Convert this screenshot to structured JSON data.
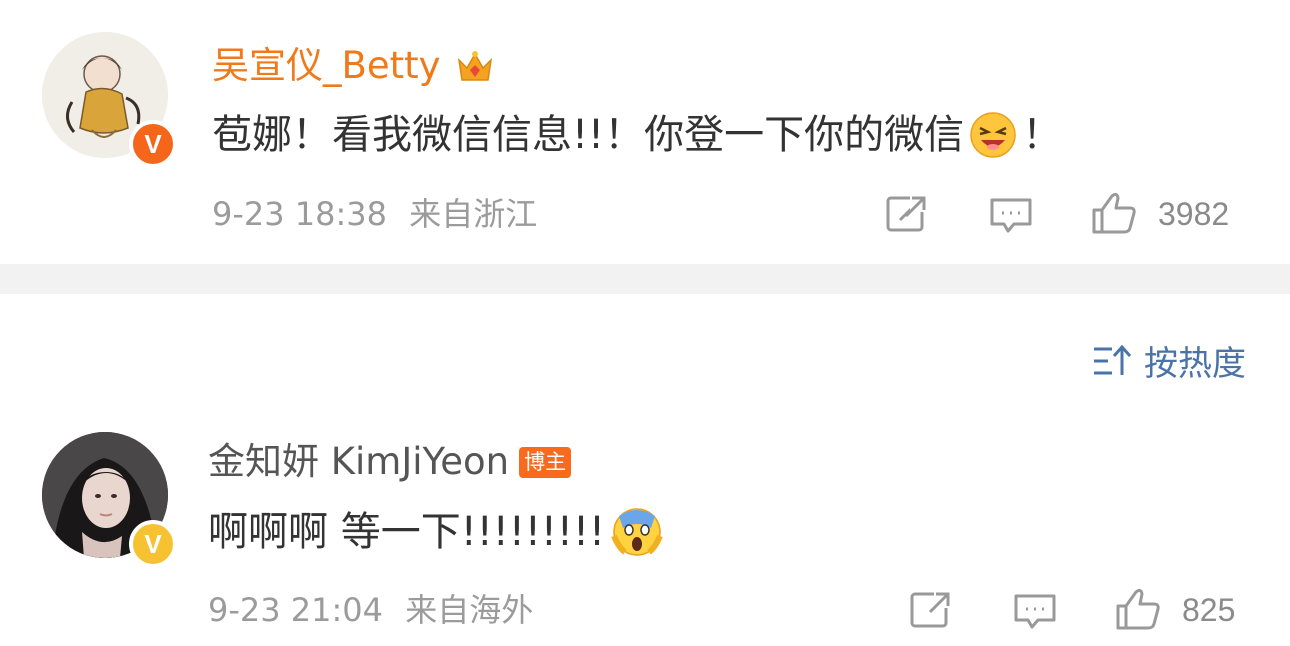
{
  "comments": [
    {
      "username": "吴宣仪_Betty",
      "text_before": "苞娜！看我微信信息!!！你登一下你的微信",
      "text_after": "！",
      "emoji": "crying-laughing-emoji",
      "timestamp": "9-23 18:38",
      "location": "来自浙江",
      "likes": "3982",
      "name_color": "#f07a1a",
      "verified_badge_color": "#f5661b",
      "crown_icon": "crown-icon"
    },
    {
      "username": "金知妍 KimJiYeon",
      "host_tag": "博主",
      "text_before": "啊啊啊 等一下!!!!!!!!!",
      "text_after": "",
      "emoji": "screaming-in-fear-emoji",
      "timestamp": "9-23 21:04",
      "location": "来自海外",
      "likes": "825",
      "name_color": "#555555",
      "verified_badge_color": "#f7c232"
    }
  ],
  "sort": {
    "label": "按热度",
    "icon": "sort-icon"
  },
  "colors": {
    "accent": "#4a74a8",
    "divider": "#f2f2f2"
  }
}
